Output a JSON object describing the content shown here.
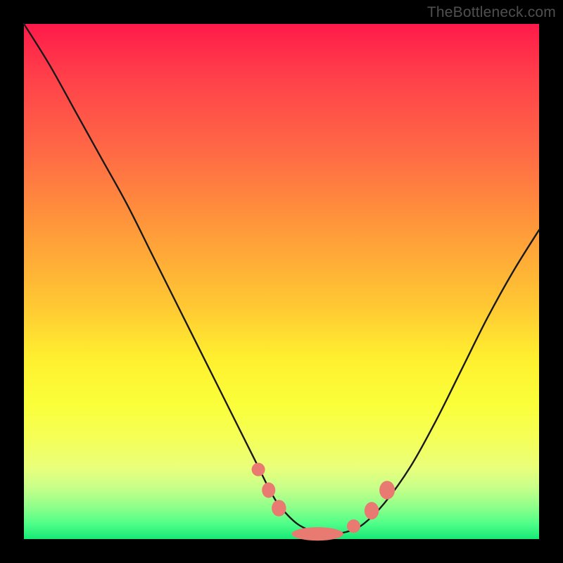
{
  "watermark": "TheBottleneck.com",
  "colors": {
    "frame": "#000000",
    "curve_stroke": "#1a1a1a",
    "marker_fill": "#e87a72",
    "gradient_top": "#ff1a4a",
    "gradient_bottom": "#17e876"
  },
  "chart_data": {
    "type": "line",
    "title": "",
    "xlabel": "",
    "ylabel": "",
    "xlim": [
      0,
      100
    ],
    "ylim": [
      0,
      100
    ],
    "grid": false,
    "legend_position": "none",
    "series": [
      {
        "name": "bottleneck-curve",
        "x": [
          0,
          5,
          10,
          15,
          20,
          25,
          30,
          35,
          40,
          45,
          48,
          50,
          53,
          56,
          58,
          60,
          63,
          66,
          70,
          75,
          80,
          85,
          90,
          95,
          100
        ],
        "values": [
          100,
          92,
          83,
          74,
          65,
          55,
          45,
          35,
          25,
          15,
          9,
          6,
          3,
          1.5,
          1,
          1,
          1.5,
          3,
          7,
          14,
          23,
          33,
          43,
          52,
          60
        ]
      }
    ],
    "markers": [
      {
        "name": "left-high",
        "x": 45.5,
        "y": 13.5,
        "rx": 1.3,
        "ry": 1.3
      },
      {
        "name": "left-mid",
        "x": 47.5,
        "y": 9.5,
        "rx": 1.3,
        "ry": 1.5
      },
      {
        "name": "left-low",
        "x": 49.5,
        "y": 6.0,
        "rx": 1.4,
        "ry": 1.6
      },
      {
        "name": "bottom-bar",
        "x": 57.0,
        "y": 1.0,
        "rx": 5.0,
        "ry": 1.3
      },
      {
        "name": "right-low",
        "x": 64.0,
        "y": 2.5,
        "rx": 1.3,
        "ry": 1.3
      },
      {
        "name": "right-mid",
        "x": 67.5,
        "y": 5.5,
        "rx": 1.4,
        "ry": 1.7
      },
      {
        "name": "right-high",
        "x": 70.5,
        "y": 9.5,
        "rx": 1.5,
        "ry": 1.8
      }
    ],
    "annotations": []
  }
}
